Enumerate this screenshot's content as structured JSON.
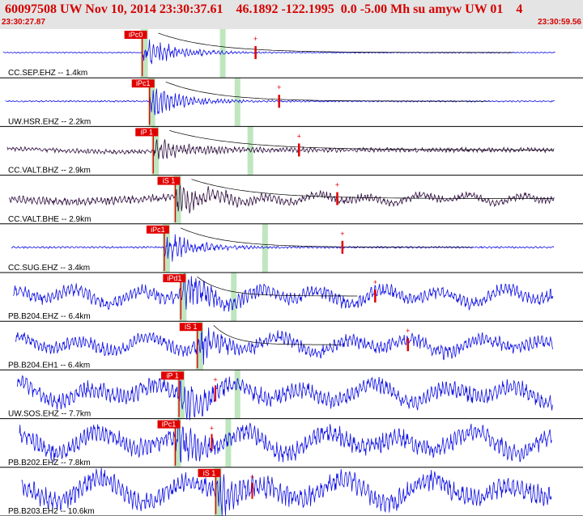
{
  "header": {
    "title": "60097508 UW Nov 10, 2014 23:30:37.61    46.1892 -122.1995  0.0 -5.00 Mh su amyw UW 01    4",
    "time_start": "23:30:27.87",
    "time_end": "23:30:59.56"
  },
  "colors": {
    "trace_blue": "#1010e6",
    "trace_dark": "#301040",
    "pick_red": "#e00000",
    "window_green": "#bfe6bf",
    "header_bg": "#e4e4e4"
  },
  "chart_data": {
    "type": "line",
    "x_range_seconds": [
      27.87,
      59.56
    ],
    "traces": [
      {
        "label": "CC.SEP.EHZ -- 1.4km",
        "pick": "iPc0",
        "pick_t": 35.6,
        "s_t": 40.0,
        "color": "blue",
        "amp": 0.95,
        "noise": 0.03,
        "tail": 11
      },
      {
        "label": "UW.HSR.EHZ -- 2.2km",
        "pick": "iPc1",
        "pick_t": 36.0,
        "s_t": 40.8,
        "color": "blue",
        "amp": 0.9,
        "noise": 0.04,
        "tail": 10
      },
      {
        "label": "CC.VALT.BHZ -- 2.9km",
        "pick": "iP 1",
        "pick_t": 36.2,
        "s_t": 41.5,
        "color": "dark",
        "amp": 0.55,
        "noise": 0.12,
        "tail": 14
      },
      {
        "label": "CC.VALT.BHE -- 2.9km",
        "pick": "iS 1",
        "pick_t": 37.4,
        "s_t": 37.4,
        "color": "dark",
        "amp": 0.75,
        "noise": 0.2,
        "tail": 12
      },
      {
        "label": "CC.SUG.EHZ -- 3.4km",
        "pick": "iPc1",
        "pick_t": 36.8,
        "s_t": 42.3,
        "color": "blue",
        "amp": 0.95,
        "noise": 0.05,
        "tail": 9
      },
      {
        "label": "PB.B204.EHZ -- 6.4km",
        "pick": "iPd1",
        "pick_t": 37.7,
        "s_t": 40.6,
        "color": "blue",
        "amp": 1.0,
        "noise": 0.35,
        "tail": 5
      },
      {
        "label": "PB.B204.EH1 -- 6.4km",
        "pick": "iS 1",
        "pick_t": 38.6,
        "s_t": 38.6,
        "color": "blue",
        "amp": 0.9,
        "noise": 0.35,
        "tail": 4
      },
      {
        "label": "UW.SOS.EHZ -- 7.7km",
        "pick": "iP 1",
        "pick_t": 37.6,
        "s_t": 40.8,
        "color": "blue",
        "amp": 0.95,
        "noise": 0.45,
        "tail": 4
      },
      {
        "label": "PB.B202.EHZ -- 7.8km",
        "pick": "iPc1",
        "pick_t": 37.4,
        "s_t": 40.3,
        "color": "blue",
        "amp": 0.9,
        "noise": 0.5,
        "tail": 4
      },
      {
        "label": "PB.B203.EH2 -- 10.6km",
        "pick": "iS 1",
        "pick_t": 39.6,
        "s_t": 39.6,
        "color": "blue",
        "amp": 0.9,
        "noise": 0.55,
        "tail": 3
      }
    ]
  }
}
